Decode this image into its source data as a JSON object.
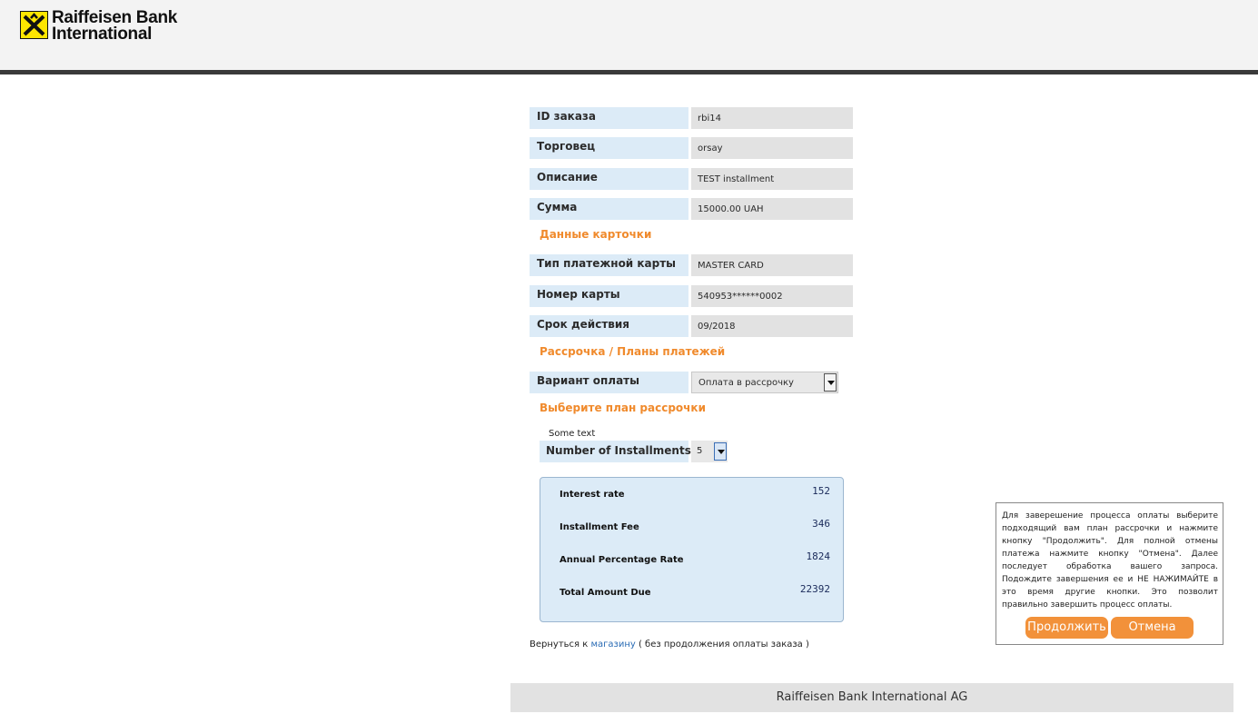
{
  "header": {
    "logo_line1": "Raiffeisen Bank",
    "logo_line2": "International"
  },
  "order": [
    {
      "label": "ID заказа",
      "value": "rbi14"
    },
    {
      "label": "Торговец",
      "value": "orsay"
    },
    {
      "label": "Описание",
      "value": "TEST installment"
    },
    {
      "label": "Сумма",
      "value": "15000.00 UAH"
    }
  ],
  "card_section_title": "Данные карточки",
  "card": [
    {
      "label": "Тип платежной карты",
      "value": "MASTER CARD"
    },
    {
      "label": "Номер карты",
      "value": "540953******0002"
    },
    {
      "label": "Срок действия",
      "value": "09/2018"
    }
  ],
  "installment_section_title": "Рассрочка / Планы платежей",
  "payment_option": {
    "label": "Вариант оплаты",
    "selected": "Оплата в рассрочку"
  },
  "plan_section_title": "Выберите план рассрочки",
  "some_text": "Some text",
  "installments": {
    "label": "Number of Installments:",
    "selected": "5"
  },
  "summary": [
    {
      "label": "Interest rate",
      "value": "152"
    },
    {
      "label": "Installment Fee",
      "value": "346"
    },
    {
      "label": "Annual Percentage Rate",
      "value": "1824"
    },
    {
      "label": "Total Amount Due",
      "value": "22392"
    }
  ],
  "back": {
    "prefix": "Вернуться к ",
    "link": "магазину",
    "suffix": " ( без продолжения оплаты заказа )"
  },
  "info_panel": {
    "text": "Для заверешение процесса оплаты выберите подходящий вам план рассрочки и нажмите кнопку \"Продолжить\". Для полной отмены платежа нажмите кнопку \"Отмена\". Далее последует обработка вашего запроса. Подождите завершения ее и НЕ НАЖИМАЙТЕ в это время другие кнопки. Это позволит правильно завершить процесс оплаты.",
    "continue_label": "Продолжить",
    "cancel_label": "Отмена"
  },
  "colors": {
    "accent": "#f2913a",
    "label_bg": "#dcebf7",
    "value_bg": "#e2e2e2",
    "logo_yellow": "#fee600"
  },
  "footer": {
    "text": "Raiffeisen Bank International AG"
  }
}
